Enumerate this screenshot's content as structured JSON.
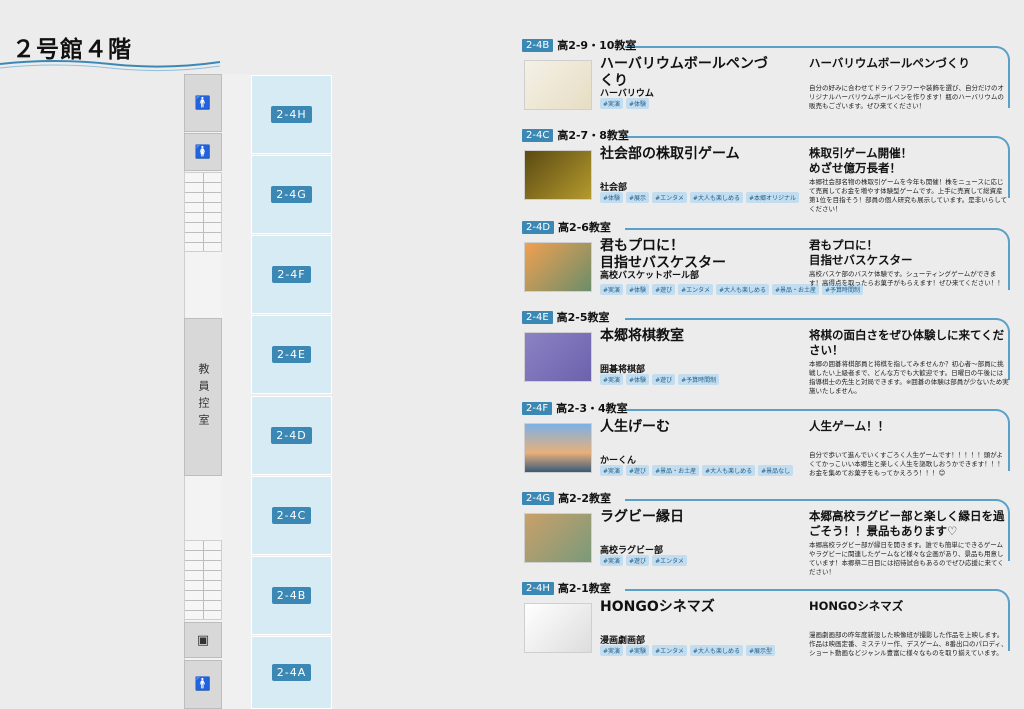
{
  "floor_title": "２号館４階",
  "teacher_room_label": "教員控室",
  "rooms": [
    "2-4H",
    "2-4G",
    "2-4F",
    "2-4E",
    "2-4D",
    "2-4C",
    "2-4B",
    "2-4A"
  ],
  "accent_color": "#3c88b4",
  "exhibits": [
    {
      "tag": "2-4B",
      "classroom": "高2-9・10教室",
      "title": "ハーバリウムボールペンづくり",
      "club": "ハーバリウム",
      "tags": [
        "#実演",
        "#体験"
      ],
      "right_title": "ハーバリウムボールペンづくり",
      "desc": "自分の好みに合わせてドライフラワーや装飾を選び、自分だけのオリジナルハーバリウムボールペンを作ります！瓶のハーバリウムの販売もございます。ぜひ来てください！"
    },
    {
      "tag": "2-4C",
      "classroom": "高2-7・8教室",
      "title": "社会部の株取引ゲーム",
      "club": "社会部",
      "tags": [
        "#体験",
        "#展示",
        "#エンタメ",
        "#大人も楽しめる",
        "#本郷オリジナル"
      ],
      "right_title": "株取引ゲーム開催！\nめざせ億万長者！",
      "desc": "本郷社会部名物の株取引ゲームを今年も開催！株をニュースに応じて売買してお金を増やす体験型ゲームです。上手に売買して総資産第1位を目指そう！部員の個人研究も展示しています。是非いらしてください！"
    },
    {
      "tag": "2-4D",
      "classroom": "高2-6教室",
      "title": "君もプロに！\n目指せバスケスター",
      "club": "高校バスケットボール部",
      "tags": [
        "#実演",
        "#体験",
        "#遊び",
        "#エンタメ",
        "#大人も楽しめる",
        "#景品・お土産",
        "#予算時間制"
      ],
      "right_title": "君もプロに！\n目指せバスケスター",
      "desc": "高校バスケ部のバスケ体験です。シューティングゲームができます！高得点を取ったらお菓子がもらえます！ぜひ来てください！！"
    },
    {
      "tag": "2-4E",
      "classroom": "高2-5教室",
      "title": "本郷将棋教室",
      "club": "囲碁将棋部",
      "tags": [
        "#実演",
        "#体験",
        "#遊び",
        "#予算時間制"
      ],
      "right_title": "将棋の面白さをぜひ体験しに来てください！",
      "desc": "本郷の囲碁将棋部員と将棋を指してみませんか？初心者～部員に挑戦したい上級者まで、どんな方でも大歓迎です。日曜日の午後には指導棋士の先生と対局できます。※囲碁の体験は部員が少ないため実施いたしません。"
    },
    {
      "tag": "2-4F",
      "classroom": "高2-3・4教室",
      "title": "人生げーむ",
      "club": "かーくん",
      "tags": [
        "#実演",
        "#遊び",
        "#景品・お土産",
        "#大人も楽しめる",
        "#景品なし"
      ],
      "right_title": "人生ゲーム！！",
      "desc": "自分で歩いて進んでいくすごろく人生ゲームです！！！！！頭がよくてかっこいい本郷生と楽しく人生を謳歌しおうかできます！！！お金を集めてお菓子をもってかえろう！！！😊"
    },
    {
      "tag": "2-4G",
      "classroom": "高2-2教室",
      "title": "ラグビー縁日",
      "club": "高校ラグビー部",
      "tags": [
        "#実演",
        "#遊び",
        "#エンタメ"
      ],
      "right_title": "本郷高校ラグビー部と楽しく縁日を過ごそう！！景品もあります♡",
      "desc": "本郷高校ラグビー部が縁日を開きます。誰でも簡単にできるゲームやラグビーに関連したゲームなど様々な企画があり、景品も用意しています！本郷祭二日目には招待試合もあるのでぜひ応援に来てください！"
    },
    {
      "tag": "2-4H",
      "classroom": "高2-1教室",
      "title": "HONGOシネマズ",
      "club": "漫画劇画部",
      "tags": [
        "#実演",
        "#実験",
        "#エンタメ",
        "#大人も楽しめる",
        "#展示型"
      ],
      "right_title": "HONGOシネマズ",
      "desc": "漫画劇画部の昨年度新設した映像班が撮影した作品を上映します。作品は映画定番、ミステリー作、デスゲーム、8番出口のパロディ、ショート動画などジャンル豊富に様々なものを取り揃えています。"
    }
  ]
}
